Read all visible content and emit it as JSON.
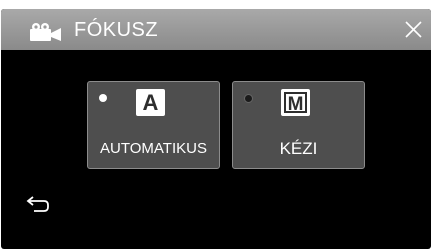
{
  "header": {
    "title": "FÓKUSZ",
    "mode_icon": "video-camera-icon",
    "close_icon": "close-icon"
  },
  "options": [
    {
      "label": "AUTOMATIKUS",
      "glyph": "A",
      "selected": true
    },
    {
      "label": "KÉZI",
      "glyph": "M",
      "selected": false
    }
  ],
  "footer": {
    "back_icon": "return-arrow-icon"
  },
  "colors": {
    "background": "#000000",
    "header": "#9a9a9a",
    "button": "#4e4e4e",
    "button_border": "#8c8c8c",
    "text": "#ffffff"
  }
}
